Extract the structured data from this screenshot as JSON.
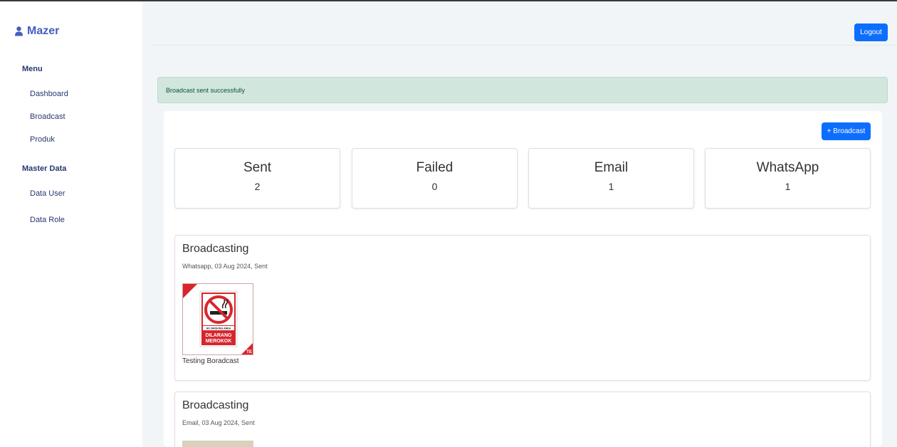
{
  "brand": {
    "name": "Mazer",
    "icon": "user-icon"
  },
  "sidebar": {
    "sections": [
      {
        "title": "Menu",
        "items": [
          "Dashboard",
          "Broadcast",
          "Produk"
        ]
      },
      {
        "title": "Master Data",
        "items": [
          "Data User",
          "Data Role"
        ]
      }
    ]
  },
  "header": {
    "logout_label": "Logout"
  },
  "alert": {
    "message": "Broadcast sent successfully"
  },
  "toolbar": {
    "add_broadcast_label": "+ Broadcast"
  },
  "stats": [
    {
      "label": "Sent",
      "value": "2"
    },
    {
      "label": "Failed",
      "value": "0"
    },
    {
      "label": "Email",
      "value": "1"
    },
    {
      "label": "WhatsApp",
      "value": "1"
    }
  ],
  "broadcasts": [
    {
      "title": "Broadcasting",
      "meta": "Whatsapp, 03 Aug 2024, Sent",
      "caption": "Testing Boradcast",
      "image": {
        "sign_small_text": "NO SMOKING AREA",
        "sign_line1": "DILARANG",
        "sign_line2": "MEROKOK",
        "corner_mark": "TE"
      }
    },
    {
      "title": "Broadcasting",
      "meta": "Email, 03 Aug 2024, Sent"
    }
  ],
  "colors": {
    "primary": "#0d6efd",
    "brand": "#435ebe",
    "alert_bg": "#d1e7dd",
    "sign_red": "#d7262d"
  }
}
